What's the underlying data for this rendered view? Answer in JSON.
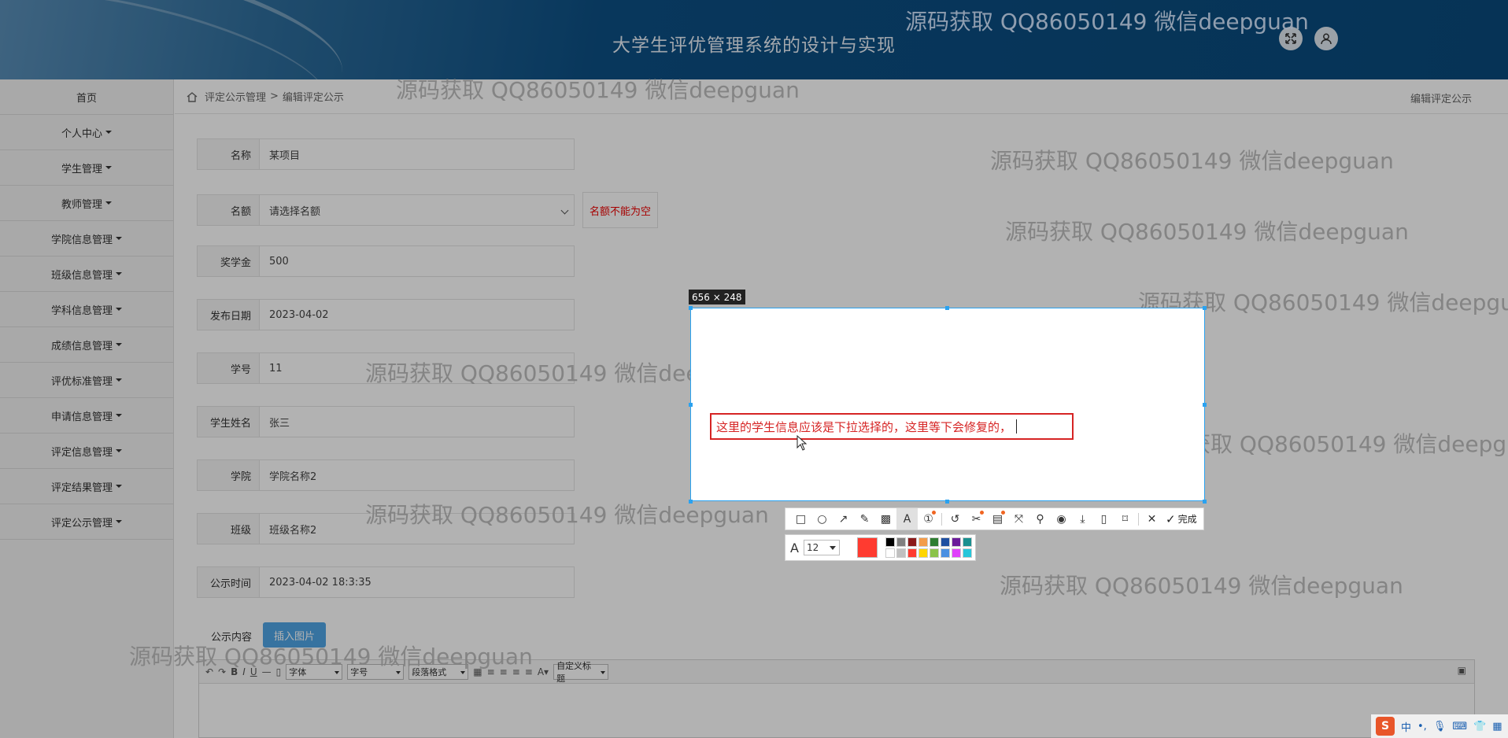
{
  "header": {
    "title": "大学生评优管理系统的设计与实现"
  },
  "sidebar": {
    "items": [
      {
        "label": "首页",
        "dropdown": false
      },
      {
        "label": "个人中心",
        "dropdown": true
      },
      {
        "label": "学生管理",
        "dropdown": true
      },
      {
        "label": "教师管理",
        "dropdown": true
      },
      {
        "label": "学院信息管理",
        "dropdown": true
      },
      {
        "label": "班级信息管理",
        "dropdown": true
      },
      {
        "label": "学科信息管理",
        "dropdown": true
      },
      {
        "label": "成绩信息管理",
        "dropdown": true
      },
      {
        "label": "评优标准管理",
        "dropdown": true
      },
      {
        "label": "申请信息管理",
        "dropdown": true
      },
      {
        "label": "评定信息管理",
        "dropdown": true
      },
      {
        "label": "评定结果管理",
        "dropdown": true
      },
      {
        "label": "评定公示管理",
        "dropdown": true
      }
    ]
  },
  "breadcrumb": {
    "parent": "评定公示管理",
    "separator": ">",
    "current": "编辑评定公示",
    "right": "编辑评定公示"
  },
  "form": {
    "name": {
      "label": "名称",
      "value": "某项目"
    },
    "quota": {
      "label": "名额",
      "placeholder": "请选择名额",
      "error": "名额不能为空"
    },
    "scholarship": {
      "label": "奖学金",
      "value": "500"
    },
    "publish_date": {
      "label": "发布日期",
      "value": "2023-04-02"
    },
    "student_no": {
      "label": "学号",
      "value": "11"
    },
    "student_name": {
      "label": "学生姓名",
      "value": "张三"
    },
    "college": {
      "label": "学院",
      "value": "学院名称2"
    },
    "class": {
      "label": "班级",
      "value": "班级名称2"
    },
    "notice_time": {
      "label": "公示时间",
      "value": "2023-04-02 18:3:35"
    },
    "content": {
      "label": "公示内容",
      "insert_image": "插入图片"
    }
  },
  "editor": {
    "font": "字体",
    "size": "字号",
    "paragraph": "段落格式",
    "custom_title": "自定义标题"
  },
  "capture": {
    "size": "656 × 248",
    "annotation": "这里的学生信息应该是下拉选择的，这里等下会修复的，",
    "done_label": "完成",
    "font_size": "12",
    "current_color": "#ff3b30",
    "palette": [
      "#000000",
      "#808080",
      "#8b1a1a",
      "#f39c4a",
      "#2e7d32",
      "#1f4fa0",
      "#6a1b9a",
      "#1a8f8f",
      "#ffffff",
      "#c0c0c0",
      "#ff3b30",
      "#ffd600",
      "#8bc34a",
      "#4a90e2",
      "#e040fb",
      "#26c6da"
    ]
  },
  "watermark": {
    "text": "源码获取 QQ86050149 微信deepguan"
  },
  "tray": {
    "ime": "S",
    "lang": "中"
  }
}
